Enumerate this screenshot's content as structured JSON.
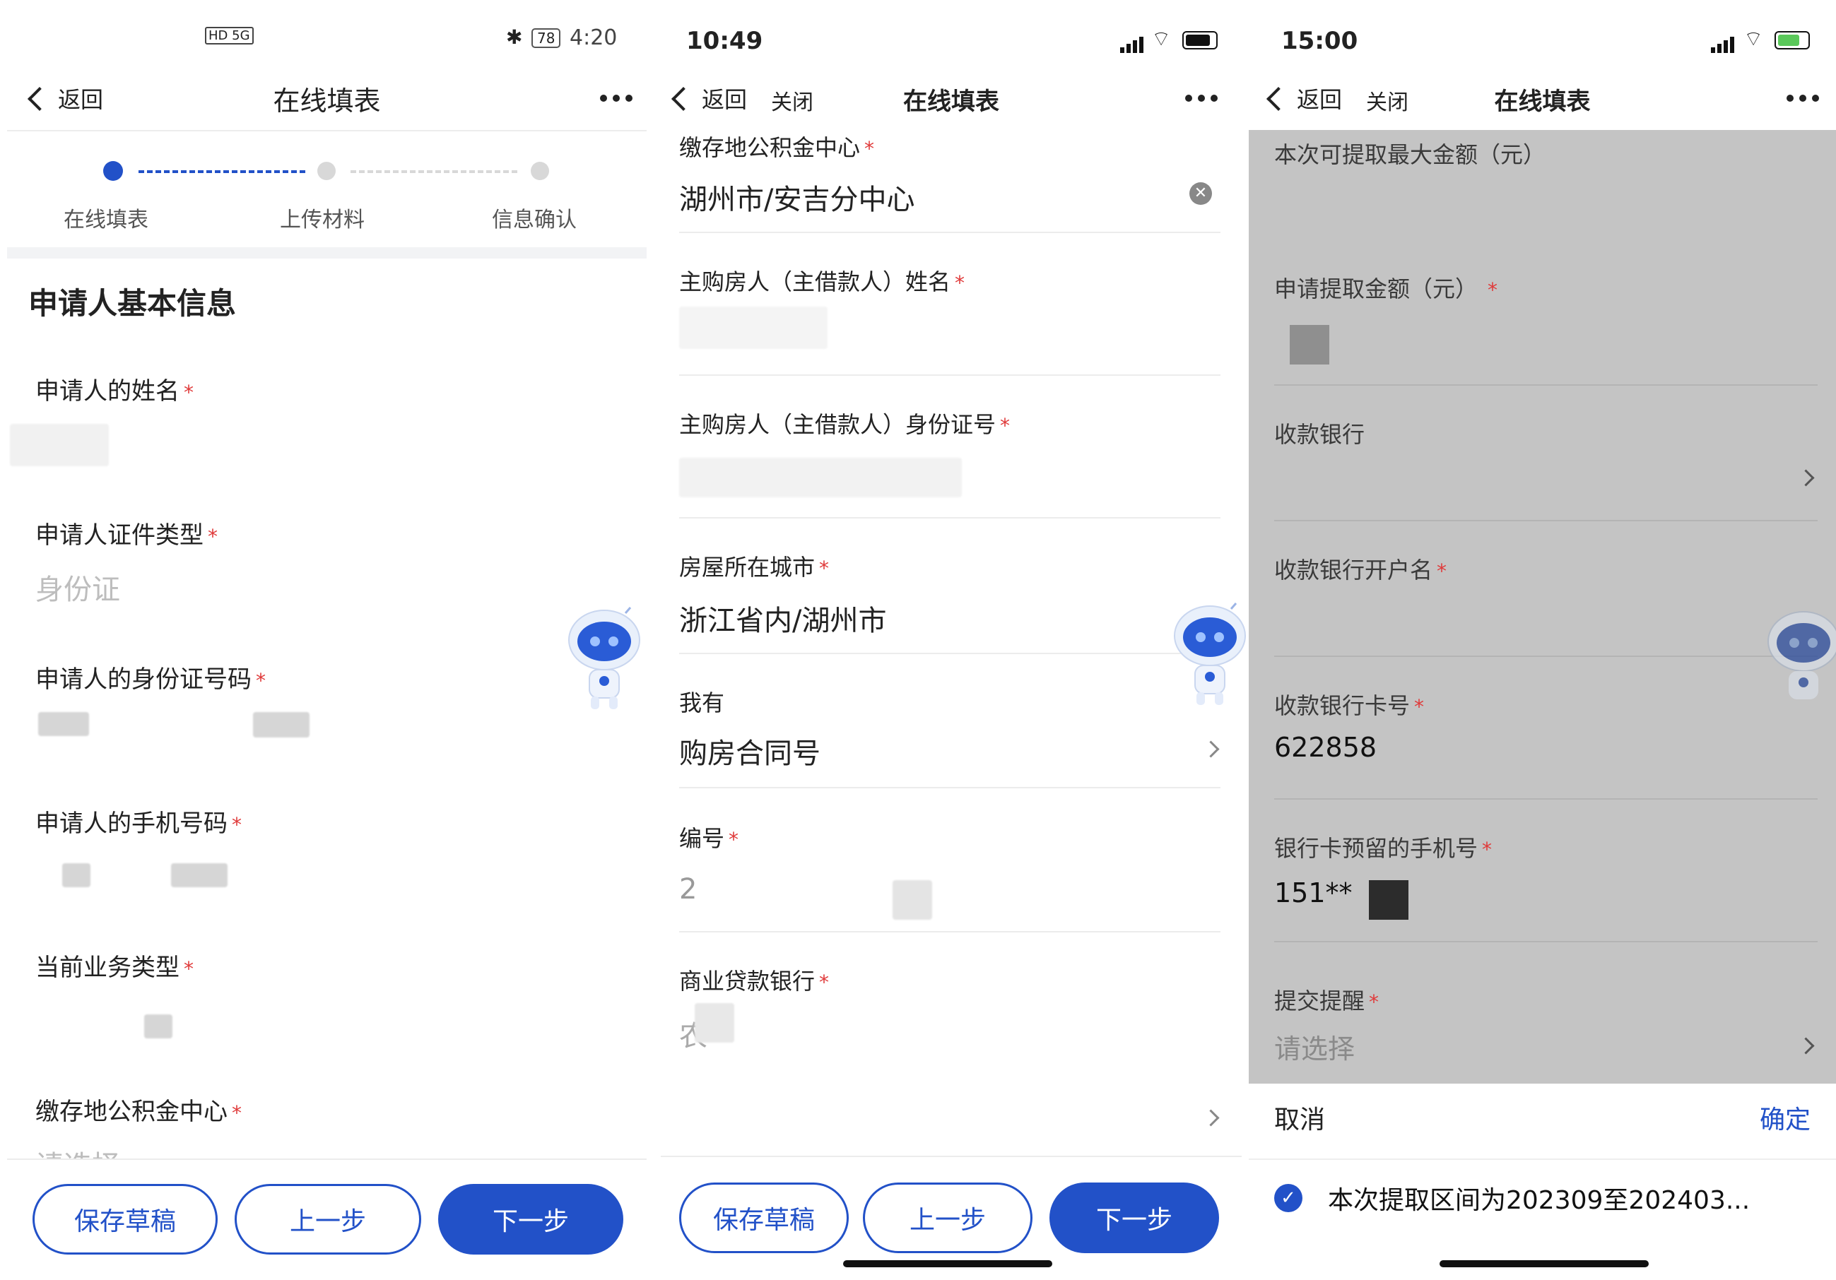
{
  "panel1": {
    "status": {
      "left_icons": "HD 5G",
      "battery": "78",
      "time": "4:20"
    },
    "nav": {
      "back": "返回",
      "title": "在线填表"
    },
    "steps": [
      {
        "label": "在线填表"
      },
      {
        "label": "上传材料"
      },
      {
        "label": "信息确认"
      }
    ],
    "section_title": "申请人基本信息",
    "fields": {
      "name_label": "申请人的姓名",
      "id_type_label": "申请人证件类型",
      "id_type_value": "身份证",
      "id_number_label": "申请人的身份证号码",
      "phone_label": "申请人的手机号码",
      "biz_type_label": "当前业务类型",
      "fund_center_label": "缴存地公积金中心",
      "fund_center_placeholder": "请选择"
    },
    "buttons": {
      "save": "保存草稿",
      "prev": "上一步",
      "next": "下一步"
    }
  },
  "panel2": {
    "status": {
      "time": "10:49"
    },
    "nav": {
      "back": "返回",
      "close": "关闭",
      "title": "在线填表"
    },
    "fields": {
      "fund_center_label": "缴存地公积金中心",
      "fund_center_value": "湖州市/安吉分中心",
      "owner_name_label": "主购房人（主借款人）姓名",
      "owner_id_label": "主购房人（主借款人）身份证号",
      "city_label": "房屋所在城市",
      "city_value": "浙江省内/湖州市",
      "have_label": "我有",
      "have_value": "购房合同号",
      "number_label": "编号",
      "number_partial": "2",
      "bank_label": "商业贷款银行",
      "bank_partial": "农"
    },
    "buttons": {
      "save": "保存草稿",
      "prev": "上一步",
      "next": "下一步"
    }
  },
  "panel3": {
    "status": {
      "time": "15:00"
    },
    "nav": {
      "back": "返回",
      "close": "关闭",
      "title": "在线填表"
    },
    "fields": {
      "max_amount_label": "本次可提取最大金额（元）",
      "apply_amount_label": "申请提取金额（元）",
      "bank_label": "收款银行",
      "account_name_label": "收款银行开户名",
      "card_label": "收款银行卡号",
      "card_value": "622858",
      "phone_label": "银行卡预留的手机号",
      "phone_value": "151**",
      "reminder_label": "提交提醒",
      "reminder_placeholder": "请选择"
    },
    "sheet": {
      "cancel": "取消",
      "confirm": "确定",
      "option": "本次提取区间为202309至202403..."
    }
  },
  "required_mark": "*",
  "colors": {
    "primary": "#2251c8",
    "required": "#e03a3a",
    "placeholder": "#bdbdbd"
  }
}
